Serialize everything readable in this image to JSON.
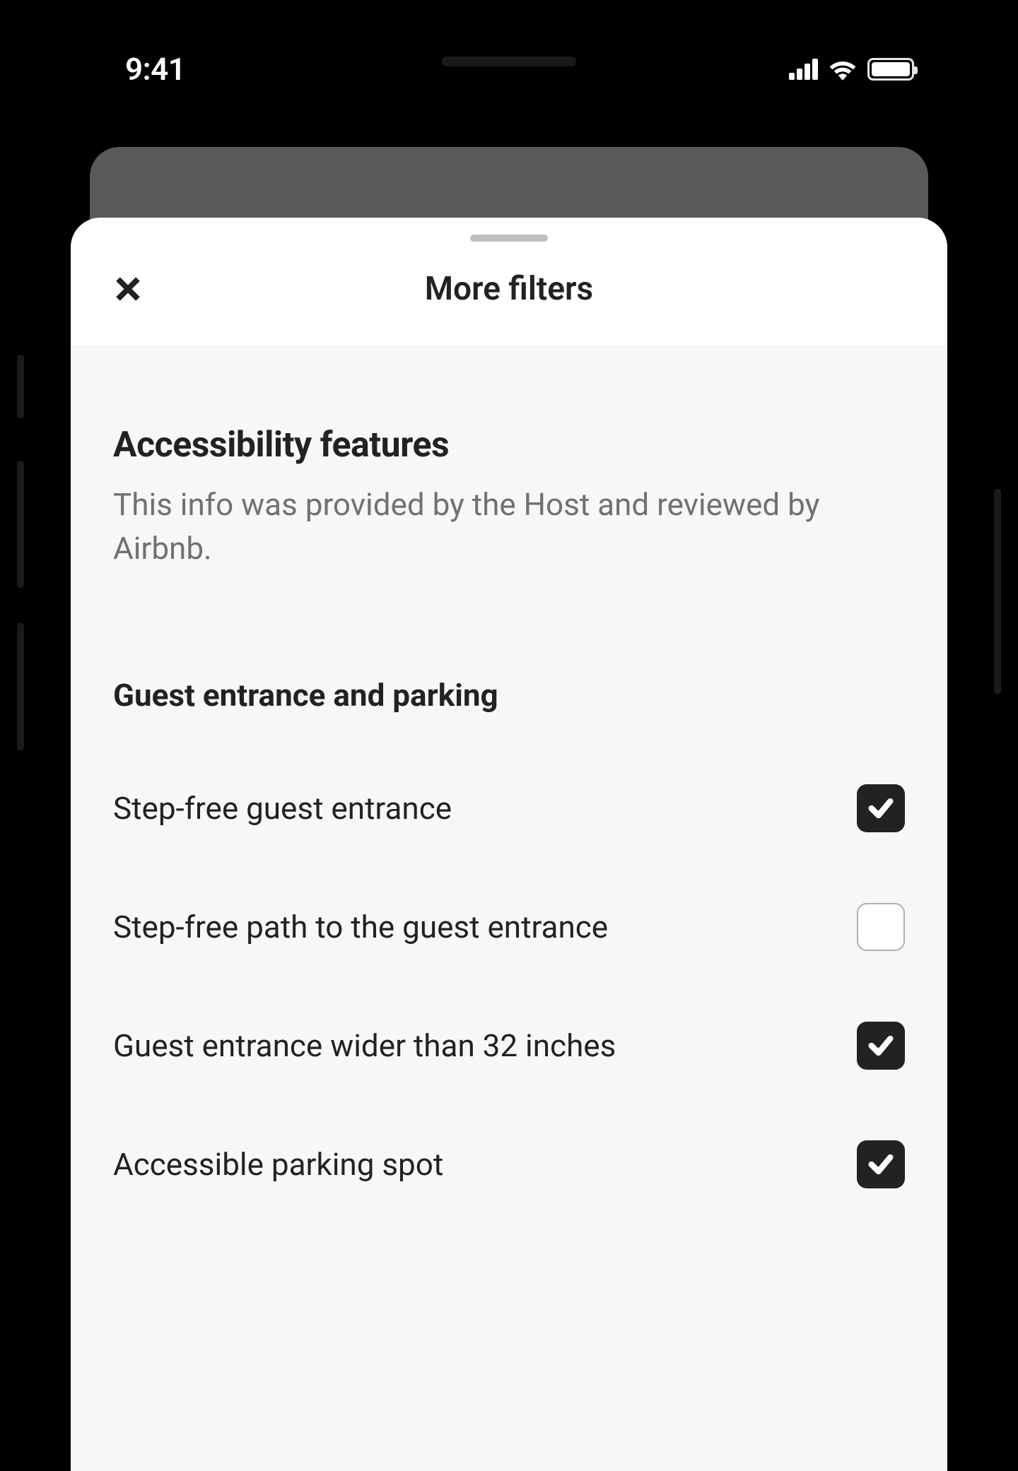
{
  "status": {
    "time": "9:41"
  },
  "header": {
    "title": "More filters"
  },
  "section": {
    "heading": "Accessibility features",
    "description": "This info was provided by the Host and reviewed by Airbnb.",
    "subsection_heading": "Guest entrance and parking"
  },
  "filters": [
    {
      "label": "Step-free guest entrance",
      "checked": true
    },
    {
      "label": "Step-free path to the guest entrance",
      "checked": false
    },
    {
      "label": "Guest entrance wider than 32 inches",
      "checked": true
    },
    {
      "label": "Accessible parking spot",
      "checked": true
    }
  ]
}
